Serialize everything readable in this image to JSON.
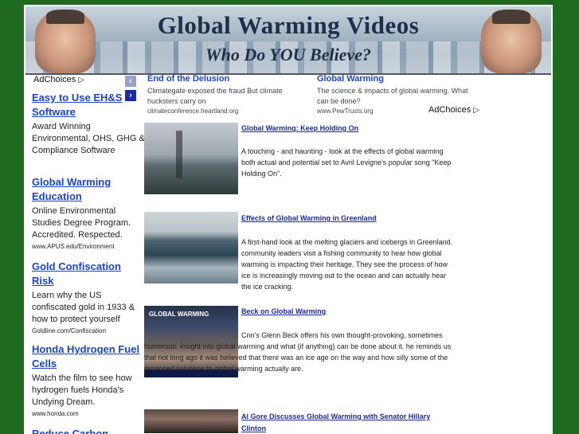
{
  "banner": {
    "title": "Global Warming Videos",
    "subtitle": "Who Do YOU Believe?"
  },
  "left_ads": {
    "adchoices": "AdChoices",
    "items": [
      {
        "title": "Easy to Use EH&S Software",
        "desc": "Award Winning Environmental, OHS, GHG & Compliance Software",
        "url": ""
      },
      {
        "title": "Global Warming Education",
        "desc": "Online Environmental Studies Degree Program. Accredited. Respected.",
        "url": "www.APUS.edu/Environment"
      },
      {
        "title": "Gold Confiscation Risk",
        "desc": "Learn why the US confiscated gold in 1933 & how to protect yourself",
        "url": "Goldline.com/Confiscation"
      },
      {
        "title": "Honda Hydrogen Fuel Cells",
        "desc": "Watch the film to see how hydrogen fuels Honda's Undying Dream.",
        "url": "www.honda.com"
      },
      {
        "title": "Reduce Carbon",
        "desc": "",
        "url": ""
      }
    ]
  },
  "top_ads": [
    {
      "title": "End of the Delusion",
      "desc": "Climategate exposed the fraud But climate hucksters carry on",
      "url": "climateconference.heartland.org"
    },
    {
      "title": "Global Warming",
      "desc": "The science & impacts of global warming. What can be done?",
      "url": "www.PewTrusts.org"
    }
  ],
  "adchoices_right": "AdChoices",
  "videos": [
    {
      "title": "Global Warming: Keep Holding On",
      "desc": "A touching - and haunting - look at the effects of global warming both actual and potential set to Avril Levigne's popular song \"Keep Holding On\"."
    },
    {
      "title": "Effects of Global Warming in Greenland",
      "desc": "A first-hand look at the melting glaciers and icebergs in Greenland. community leaders visit a fishing community to hear how global warming is impacting their heritage. They see the process of how ice is increasingly moving out to the ocean and can actually hear the ice cracking."
    },
    {
      "title": "Beck on Global Warming",
      "desc": "Cnn's Glenn Beck offers his own thought-provoking, sometimes humorous, insight into global warming and what (if anything) can be done about it. he reminds us that not long ago it was believed that there was an ice age on the way and how silly some of the proposed solutions to global warming actually are."
    },
    {
      "title": "Al Gore Discusses Global Warming with Senator Hillary Clinton",
      "desc": ""
    }
  ],
  "thumb3_label": "GLOBAL WARMING",
  "colors": {
    "background": "#1e6a1e",
    "link": "#1a44c8",
    "video_link": "#1a2a9a"
  }
}
